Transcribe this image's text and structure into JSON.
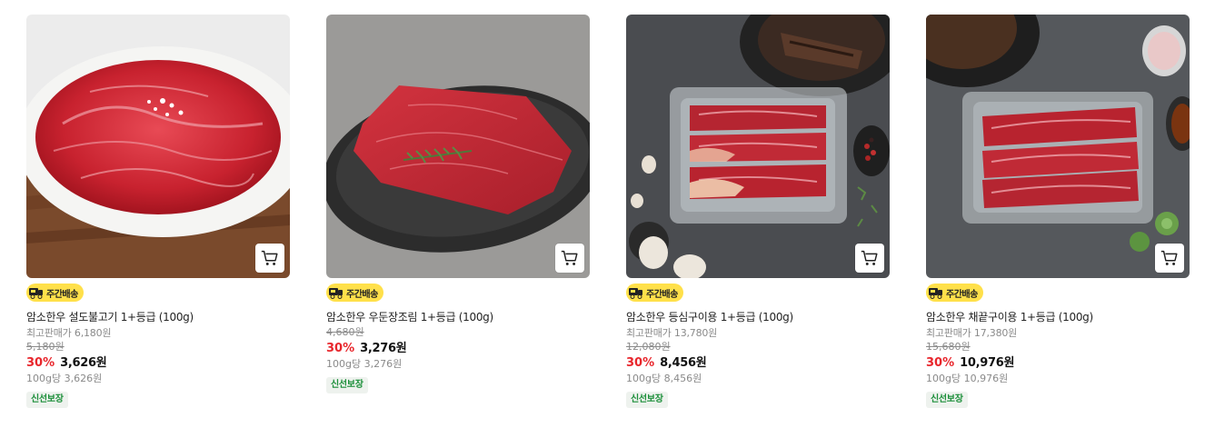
{
  "products": [
    {
      "image_alt": "소고기 설도 불고기",
      "badge": "주간배송",
      "name": "암소한우 설도불고기 1+등급 (100g)",
      "best_price": "최고판매가 6,180원",
      "original_price": "5,180원",
      "discount": "30%",
      "price": "3,626원",
      "unit_price": "100g당 3,626원",
      "tag": "신선보장"
    },
    {
      "image_alt": "소고기 우둔 장조림",
      "badge": "주간배송",
      "name": "암소한우 우둔장조림 1+등급 (100g)",
      "best_price": "",
      "original_price": "4,680원",
      "discount": "30%",
      "price": "3,276원",
      "unit_price": "100g당 3,276원",
      "tag": "신선보장"
    },
    {
      "image_alt": "소고기 등심 구이용",
      "badge": "주간배송",
      "name": "암소한우 등심구이용 1+등급 (100g)",
      "best_price": "최고판매가 13,780원",
      "original_price": "12,080원",
      "discount": "30%",
      "price": "8,456원",
      "unit_price": "100g당 8,456원",
      "tag": "신선보장"
    },
    {
      "image_alt": "소고기 채끝 구이용",
      "badge": "주간배송",
      "name": "암소한우 채끝구이용 1+등급 (100g)",
      "best_price": "최고판매가 17,380원",
      "original_price": "15,680원",
      "discount": "30%",
      "price": "10,976원",
      "unit_price": "100g당 10,976원",
      "tag": "신선보장"
    }
  ],
  "colors": {
    "discount": "#e8262c",
    "badge_bg": "#ffe04a",
    "fresh_text": "#1c8f3a"
  },
  "icons": {
    "cart": "cart-icon",
    "truck": "truck-icon"
  }
}
